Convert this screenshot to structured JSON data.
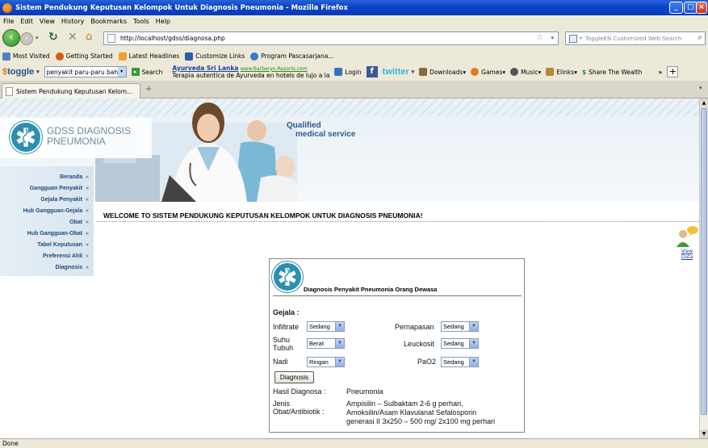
{
  "window": {
    "title": "Sistem Pendukung Keputusan Kelompok Untuk Diagnosis Pneumonia - Mozilla Firefox"
  },
  "menu": [
    "File",
    "Edit",
    "View",
    "History",
    "Bookmarks",
    "Tools",
    "Help"
  ],
  "nav": {
    "url": "http://localhost/gdss/diagnosa.php",
    "search_placeholder": "ToggleEN Customized Web Search"
  },
  "bookmarks": [
    "Most Visited",
    "Getting Started",
    "Latest Headlines",
    "Customize Links",
    "Program Pascasarjana..."
  ],
  "toolbar": {
    "toggle_label": "toggle",
    "search_value": "penyakit paru-paru bahas",
    "search_label": "Search",
    "ad_title": "Ayurveda Sri Lanka",
    "ad_url": "www.Barberyn-Resorts.com",
    "ad_text": "Terapia autentica de Ayurveda en hotels de lujo a la",
    "login": "Login",
    "twitter": "twitter",
    "downloads": "Downloads",
    "games": "Games",
    "music": "Music",
    "elinks": "Elinks",
    "share": "Share The Wealth",
    "more": "»"
  },
  "tab": {
    "label": "Sistem Pendukung Keputusan Kelom..."
  },
  "status": "Done",
  "site": {
    "logo_line1": "GDSS DIAGNOSIS",
    "logo_line2": "PNEUMONIA",
    "tagline1": "Qualified",
    "tagline2": "medical service",
    "welcome": "WELCOME TO SISTEM PENDUKUNG KEPUTUSAN KELOMPOK UNTUK DIAGNOSIS PNEUMONIA!",
    "view_data": "View Data"
  },
  "sidebar": [
    "Beranda",
    "Gangguan Penyakit",
    "Gejala Penyakit",
    "Hub Gangguan-Gejala",
    "Obat",
    "Hub Gangguan-Obat",
    "Tabel Keputusan",
    "Preferensi Ahli",
    "Diagnosis"
  ],
  "form": {
    "title": "Diagnosis Penyakit Pneumonia Orang Dewasa",
    "section": "Gejala :",
    "infiltrate_label": "Infiltrate",
    "infiltrate_value": "Sedang",
    "suhu_label1": "Suhu",
    "suhu_label2": "Tubuh",
    "suhu_value": "Berat",
    "nadi_label": "Nadi",
    "nadi_value": "Ringan",
    "pernapasan_label": "Pernapasan",
    "pernapasan_value": "Sedang",
    "leukosit_label": "Leuckosit",
    "leukosit_value": "Sedang",
    "pao2_label": "PaO2",
    "pao2_value": "Sedang",
    "button": "Diagnosis",
    "hasil_label": "Hasil Diagnosa :",
    "hasil_value": "Pneumonia",
    "jenis_label1": "Jenis",
    "jenis_label2": "Obat/Antibiotik :",
    "obat1": "Ampisilin – Sulbaktam 2-6 g perhari,",
    "obat2": "Amoksilin/Asam Klavulanat Sefalosporin",
    "obat3": "generasi II 3x250 – 500 mg/ 2x100 mg perhari"
  }
}
